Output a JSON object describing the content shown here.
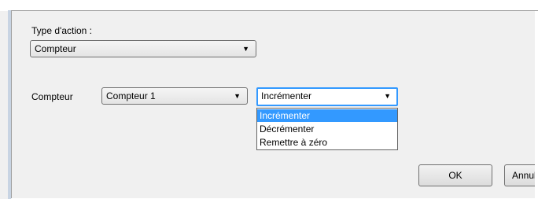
{
  "action_type": {
    "label": "Type d'action :",
    "selected": "Compteur",
    "arrow": "▼"
  },
  "counter_row": {
    "label": "Compteur",
    "counter_select": {
      "selected": "Compteur 1",
      "arrow": "▼"
    },
    "operation_select": {
      "selected": "Incrémenter",
      "arrow": "▼",
      "options": [
        "Incrémenter",
        "Décrémenter",
        "Remettre à zéro"
      ],
      "highlighted_index": 0
    }
  },
  "buttons": {
    "ok": "OK",
    "cancel": "Annuler"
  },
  "colors": {
    "highlight": "#3399ff",
    "focus_border": "#3399ff",
    "dialog_bg": "#f0f0f0"
  }
}
